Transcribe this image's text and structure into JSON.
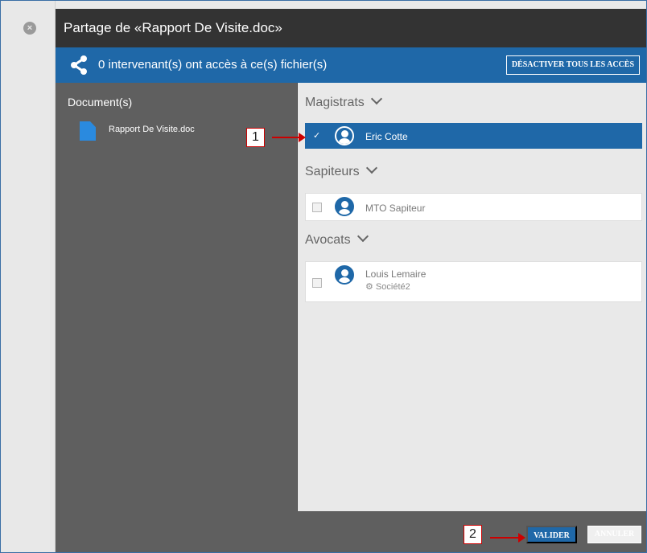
{
  "dialog": {
    "title": "Partage de «Rapport De Visite.doc»",
    "close_icon": "close-icon"
  },
  "share_bar": {
    "icon": "share-icon",
    "text": "0 intervenant(s) ont accès à ce(s) fichier(s)",
    "disable_all_label": "DÉSACTIVER TOUS LES ACCÈS"
  },
  "documents": {
    "title": "Document(s)",
    "items": [
      {
        "name": "Rapport De Visite.doc",
        "icon": "document-icon"
      }
    ]
  },
  "groups": [
    {
      "name": "Magistrats",
      "people": [
        {
          "name": "Eric Cotte",
          "selected": true,
          "icon": "user-avatar-icon"
        }
      ]
    },
    {
      "name": "Sapiteurs",
      "people": [
        {
          "name": "MTO Sapiteur",
          "selected": false,
          "icon": "user-avatar-icon"
        }
      ]
    },
    {
      "name": "Avocats",
      "people": [
        {
          "name": "Louis Lemaire",
          "organization": "Société2",
          "selected": false,
          "icon": "lawyer-avatar-icon"
        }
      ]
    }
  ],
  "footer": {
    "validate_label": "VALIDER",
    "cancel_label": "ANNULER"
  },
  "annotations": {
    "callout_1": "1",
    "callout_2": "2"
  },
  "colors": {
    "accent": "#1f68a8",
    "titlebar": "#333333",
    "panel_dark": "#5f5f5f",
    "annotation": "#cc0000"
  }
}
